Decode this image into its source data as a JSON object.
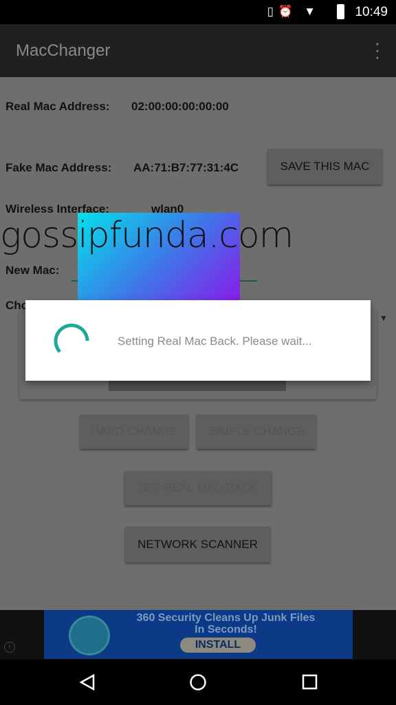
{
  "status_bar": {
    "time": "10:49",
    "icons": [
      "vibrate-icon",
      "alarm-icon",
      "wifi-icon",
      "battery-icon"
    ]
  },
  "app_bar": {
    "title": "MacChanger",
    "menu_icon": "more-vert-icon"
  },
  "main": {
    "real_mac_label": "Real Mac Address:",
    "real_mac_value": "02:00:00:00:00:00",
    "fake_mac_label": "Fake Mac Address:",
    "fake_mac_value": "AA:71:B7:77:31:4C",
    "save_button": "SAVE THIS MAC",
    "interface_label": "Wireless Interface:",
    "interface_value": "wlan0",
    "new_mac_label": "New Mac:",
    "new_mac_value": "",
    "choose_label": "Cho",
    "hard_change": "HARD CHANGE",
    "simple_change": "SIMPLE CHANGE",
    "set_real_mac_back": "SET REAL MAC BACK",
    "network_scanner": "NETWORK SCANNER"
  },
  "watermark": {
    "text": "gossipfunda.com"
  },
  "dialog": {
    "message": "Setting Real Mac Back. Please wait...",
    "spinner_color": "#1ea896"
  },
  "ad": {
    "line1": "360 Security Cleans Up Junk Files",
    "line2": "In Seconds!",
    "button": "INSTALL"
  },
  "nav": {
    "back": "back-icon",
    "home": "home-icon",
    "recents": "recents-icon"
  }
}
